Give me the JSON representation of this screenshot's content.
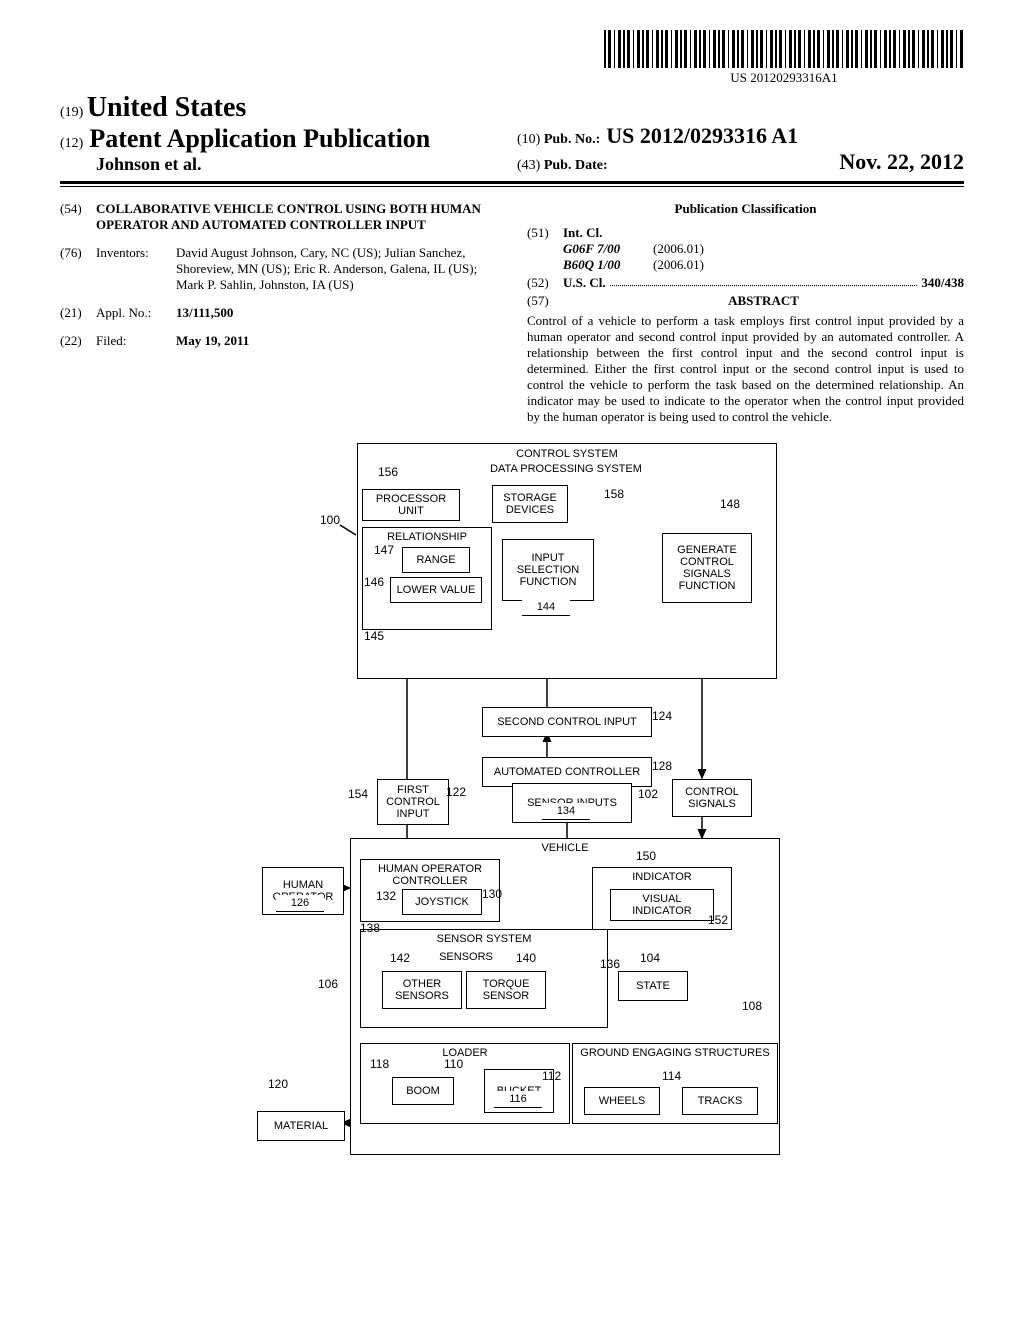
{
  "barcode_label": "US 20120293316A1",
  "header": {
    "code19": "(19)",
    "country": "United States",
    "code12": "(12)",
    "pub_type": "Patent Application Publication",
    "authors": "Johnson et al.",
    "code10": "(10)",
    "pubno_label": "Pub. No.:",
    "pubno": "US 2012/0293316 A1",
    "code43": "(43)",
    "pubdate_label": "Pub. Date:",
    "pubdate": "Nov. 22, 2012"
  },
  "biblio": {
    "f54_code": "(54)",
    "f54_val": "COLLABORATIVE VEHICLE CONTROL USING BOTH HUMAN OPERATOR AND AUTOMATED CONTROLLER INPUT",
    "f76_code": "(76)",
    "f76_label": "Inventors:",
    "f76_val": "David August Johnson, Cary, NC (US); Julian Sanchez, Shoreview, MN (US); Eric R. Anderson, Galena, IL (US); Mark P. Sahlin, Johnston, IA (US)",
    "f21_code": "(21)",
    "f21_label": "Appl. No.:",
    "f21_val": "13/111,500",
    "f22_code": "(22)",
    "f22_label": "Filed:",
    "f22_val": "May 19, 2011",
    "class_head": "Publication Classification",
    "f51_code": "(51)",
    "f51_label": "Int. Cl.",
    "intcl": [
      {
        "c": "G06F 7/00",
        "v": "(2006.01)"
      },
      {
        "c": "B60Q 1/00",
        "v": "(2006.01)"
      }
    ],
    "f52_code": "(52)",
    "f52_label": "U.S. Cl.",
    "f52_val": "340/438",
    "f57_code": "(57)",
    "f57_label": "ABSTRACT",
    "abstract": "Control of a vehicle to perform a task employs first control input provided by a human operator and second control input provided by an automated controller. A relationship between the first control input and the second control input is determined. Either the first control input or the second control input is used to control the vehicle to perform the task based on the determined relationship. An indicator may be used to indicate to the operator when the control input provided by the human operator is being used to control the vehicle."
  },
  "fig": {
    "control_system": "CONTROL SYSTEM",
    "dps": "DATA PROCESSING SYSTEM",
    "processor": "PROCESSOR UNIT",
    "storage": "STORAGE DEVICES",
    "relationship": "RELATIONSHIP",
    "range": "RANGE",
    "lower_value": "LOWER VALUE",
    "input_sel": "INPUT SELECTION FUNCTION",
    "gen_ctrl": "GENERATE CONTROL SIGNALS FUNCTION",
    "second_ci": "SECOND CONTROL INPUT",
    "auto_ctrl": "AUTOMATED CONTROLLER",
    "first_ci": "FIRST CONTROL INPUT",
    "sensor_inputs": "SENSOR INPUTS",
    "control_signals": "CONTROL SIGNALS",
    "vehicle": "VEHICLE",
    "hoc": "HUMAN OPERATOR CONTROLLER",
    "joystick": "JOYSTICK",
    "human_op": "HUMAN OPERATOR",
    "indicator": "INDICATOR",
    "visual_ind": "VISUAL INDICATOR",
    "sensor_system": "SENSOR SYSTEM",
    "sensors": "SENSORS",
    "other_sensors": "OTHER SENSORS",
    "torque_sensor": "TORQUE SENSOR",
    "state": "STATE",
    "loader": "LOADER",
    "boom": "BOOM",
    "bucket": "BUCKET",
    "ges": "GROUND ENGAGING STRUCTURES",
    "wheels": "WHEELS",
    "tracks": "TRACKS",
    "material": "MATERIAL",
    "n100": "100",
    "n102": "102",
    "n104": "104",
    "n106": "106",
    "n108": "108",
    "n110": "110",
    "n112": "112",
    "n114": "114",
    "n116": "116",
    "n118": "118",
    "n120": "120",
    "n122": "122",
    "n124": "124",
    "n126": "126",
    "n128": "128",
    "n130": "130",
    "n132": "132",
    "n134": "134",
    "n136": "136",
    "n138": "138",
    "n140": "140",
    "n142": "142",
    "n144": "144",
    "n145": "145",
    "n146": "146",
    "n147": "147",
    "n148": "148",
    "n150": "150",
    "n152": "152",
    "n154": "154",
    "n156": "156",
    "n158": "158"
  }
}
